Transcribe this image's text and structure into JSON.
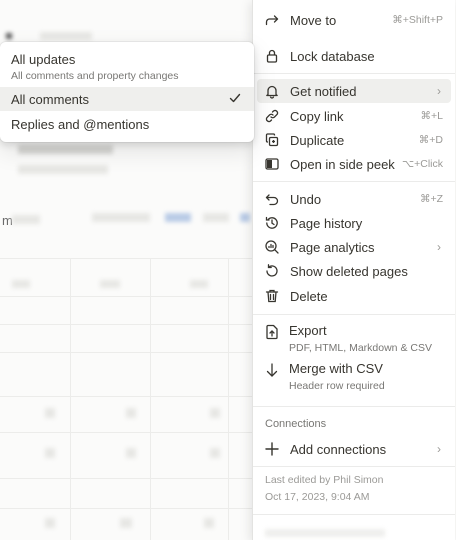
{
  "background": {
    "visible_letter": "m"
  },
  "notify_submenu": {
    "options": [
      {
        "label": "All updates",
        "description": "All comments and property changes",
        "selected": false
      },
      {
        "label": "All comments",
        "description": "",
        "selected": true
      },
      {
        "label": "Replies and @mentions",
        "description": "",
        "selected": false
      }
    ]
  },
  "menu": {
    "move_to": {
      "label": "Move to",
      "shortcut": "⌘+Shift+P",
      "icon": "arrow-right-icon"
    },
    "lock_database": {
      "label": "Lock database",
      "icon": "lock-icon"
    },
    "get_notified": {
      "label": "Get notified",
      "icon": "bell-icon",
      "highlighted": true
    },
    "copy_link": {
      "label": "Copy link",
      "shortcut": "⌘+L",
      "icon": "link-icon"
    },
    "duplicate": {
      "label": "Duplicate",
      "shortcut": "⌘+D",
      "icon": "duplicate-icon"
    },
    "open_side_peek": {
      "label": "Open in side peek",
      "shortcut": "⌥+Click",
      "icon": "side-peek-icon"
    },
    "undo": {
      "label": "Undo",
      "shortcut": "⌘+Z",
      "icon": "undo-icon"
    },
    "page_history": {
      "label": "Page history",
      "icon": "history-icon"
    },
    "page_analytics": {
      "label": "Page analytics",
      "icon": "analytics-icon"
    },
    "show_deleted": {
      "label": "Show deleted pages",
      "icon": "restore-icon"
    },
    "delete": {
      "label": "Delete",
      "icon": "trash-icon"
    },
    "export": {
      "label": "Export",
      "sublabel": "PDF, HTML, Markdown & CSV",
      "icon": "export-icon"
    },
    "merge_csv": {
      "label": "Merge with CSV",
      "sublabel": "Header row required",
      "icon": "download-arrow-icon"
    },
    "connections_heading": "Connections",
    "add_connections": {
      "label": "Add connections",
      "icon": "plus-icon"
    },
    "last_edited": "Last edited by Phil Simon",
    "last_edited_date": "Oct 17, 2023, 9:04 AM"
  },
  "colors": {
    "menu_text": "#37352f",
    "muted_text": "#9b9a97",
    "highlight_bg": "#efefed"
  }
}
